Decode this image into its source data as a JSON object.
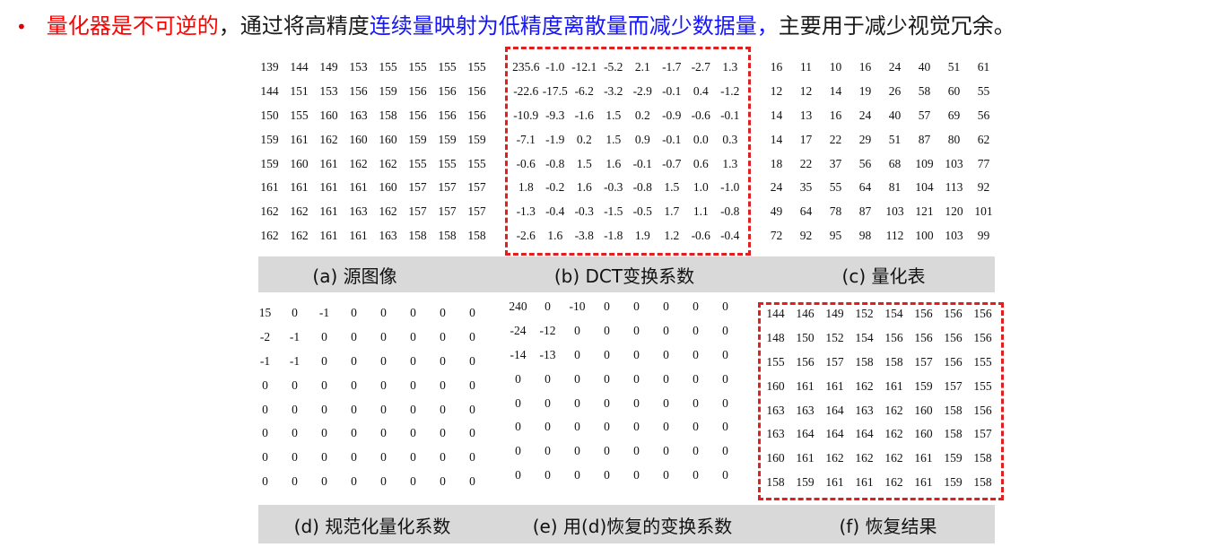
{
  "headline": {
    "bullet": "•",
    "part_red": "量化器是不可逆的",
    "part_black1": "，通过将高精度",
    "part_blue": "连续量映射为低精度离散量而减少数据量，",
    "part_black2": "主要用于减少视觉冗余。"
  },
  "captions": {
    "a": "(a) 源图像",
    "b": "(b) DCT变换系数",
    "c": "(c) 量化表",
    "d": "(d) 规范化量化系数",
    "e": "(e) 用(d)恢复的变换系数",
    "f": "(f)  恢复结果"
  },
  "matrices": {
    "a": [
      [
        "139",
        "144",
        "149",
        "153",
        "155",
        "155",
        "155",
        "155"
      ],
      [
        "144",
        "151",
        "153",
        "156",
        "159",
        "156",
        "156",
        "156"
      ],
      [
        "150",
        "155",
        "160",
        "163",
        "158",
        "156",
        "156",
        "156"
      ],
      [
        "159",
        "161",
        "162",
        "160",
        "160",
        "159",
        "159",
        "159"
      ],
      [
        "159",
        "160",
        "161",
        "162",
        "162",
        "155",
        "155",
        "155"
      ],
      [
        "161",
        "161",
        "161",
        "161",
        "160",
        "157",
        "157",
        "157"
      ],
      [
        "162",
        "162",
        "161",
        "163",
        "162",
        "157",
        "157",
        "157"
      ],
      [
        "162",
        "162",
        "161",
        "161",
        "163",
        "158",
        "158",
        "158"
      ]
    ],
    "b": [
      [
        "235.6",
        "-1.0",
        "-12.1",
        "-5.2",
        "2.1",
        "-1.7",
        "-2.7",
        "1.3"
      ],
      [
        "-22.6",
        "-17.5",
        "-6.2",
        "-3.2",
        "-2.9",
        "-0.1",
        "0.4",
        "-1.2"
      ],
      [
        "-10.9",
        "-9.3",
        "-1.6",
        "1.5",
        "0.2",
        "-0.9",
        "-0.6",
        "-0.1"
      ],
      [
        "-7.1",
        "-1.9",
        "0.2",
        "1.5",
        "0.9",
        "-0.1",
        "0.0",
        "0.3"
      ],
      [
        "-0.6",
        "-0.8",
        "1.5",
        "1.6",
        "-0.1",
        "-0.7",
        "0.6",
        "1.3"
      ],
      [
        "1.8",
        "-0.2",
        "1.6",
        "-0.3",
        "-0.8",
        "1.5",
        "1.0",
        "-1.0"
      ],
      [
        "-1.3",
        "-0.4",
        "-0.3",
        "-1.5",
        "-0.5",
        "1.7",
        "1.1",
        "-0.8"
      ],
      [
        "-2.6",
        "1.6",
        "-3.8",
        "-1.8",
        "1.9",
        "1.2",
        "-0.6",
        "-0.4"
      ]
    ],
    "c": [
      [
        "16",
        "11",
        "10",
        "16",
        "24",
        "40",
        "51",
        "61"
      ],
      [
        "12",
        "12",
        "14",
        "19",
        "26",
        "58",
        "60",
        "55"
      ],
      [
        "14",
        "13",
        "16",
        "24",
        "40",
        "57",
        "69",
        "56"
      ],
      [
        "14",
        "17",
        "22",
        "29",
        "51",
        "87",
        "80",
        "62"
      ],
      [
        "18",
        "22",
        "37",
        "56",
        "68",
        "109",
        "103",
        "77"
      ],
      [
        "24",
        "35",
        "55",
        "64",
        "81",
        "104",
        "113",
        "92"
      ],
      [
        "49",
        "64",
        "78",
        "87",
        "103",
        "121",
        "120",
        "101"
      ],
      [
        "72",
        "92",
        "95",
        "98",
        "112",
        "100",
        "103",
        "99"
      ]
    ],
    "d": [
      [
        "15",
        "0",
        "-1",
        "0",
        "0",
        "0",
        "0",
        "0"
      ],
      [
        "-2",
        "-1",
        "0",
        "0",
        "0",
        "0",
        "0",
        "0"
      ],
      [
        "-1",
        "-1",
        "0",
        "0",
        "0",
        "0",
        "0",
        "0"
      ],
      [
        "0",
        "0",
        "0",
        "0",
        "0",
        "0",
        "0",
        "0"
      ],
      [
        "0",
        "0",
        "0",
        "0",
        "0",
        "0",
        "0",
        "0"
      ],
      [
        "0",
        "0",
        "0",
        "0",
        "0",
        "0",
        "0",
        "0"
      ],
      [
        "0",
        "0",
        "0",
        "0",
        "0",
        "0",
        "0",
        "0"
      ],
      [
        "0",
        "0",
        "0",
        "0",
        "0",
        "0",
        "0",
        "0"
      ]
    ],
    "e": [
      [
        "240",
        "0",
        "-10",
        "0",
        "0",
        "0",
        "0",
        "0"
      ],
      [
        "-24",
        "-12",
        "0",
        "0",
        "0",
        "0",
        "0",
        "0"
      ],
      [
        "-14",
        "-13",
        "0",
        "0",
        "0",
        "0",
        "0",
        "0"
      ],
      [
        "0",
        "0",
        "0",
        "0",
        "0",
        "0",
        "0",
        "0"
      ],
      [
        "0",
        "0",
        "0",
        "0",
        "0",
        "0",
        "0",
        "0"
      ],
      [
        "0",
        "0",
        "0",
        "0",
        "0",
        "0",
        "0",
        "0"
      ],
      [
        "0",
        "0",
        "0",
        "0",
        "0",
        "0",
        "0",
        "0"
      ],
      [
        "0",
        "0",
        "0",
        "0",
        "0",
        "0",
        "0",
        "0"
      ]
    ],
    "f": [
      [
        "144",
        "146",
        "149",
        "152",
        "154",
        "156",
        "156",
        "156"
      ],
      [
        "148",
        "150",
        "152",
        "154",
        "156",
        "156",
        "156",
        "156"
      ],
      [
        "155",
        "156",
        "157",
        "158",
        "158",
        "157",
        "156",
        "155"
      ],
      [
        "160",
        "161",
        "161",
        "162",
        "161",
        "159",
        "157",
        "155"
      ],
      [
        "163",
        "163",
        "164",
        "163",
        "162",
        "160",
        "158",
        "156"
      ],
      [
        "163",
        "164",
        "164",
        "164",
        "162",
        "160",
        "158",
        "157"
      ],
      [
        "160",
        "161",
        "162",
        "162",
        "162",
        "161",
        "159",
        "158"
      ],
      [
        "158",
        "159",
        "161",
        "161",
        "162",
        "161",
        "159",
        "158"
      ]
    ]
  }
}
